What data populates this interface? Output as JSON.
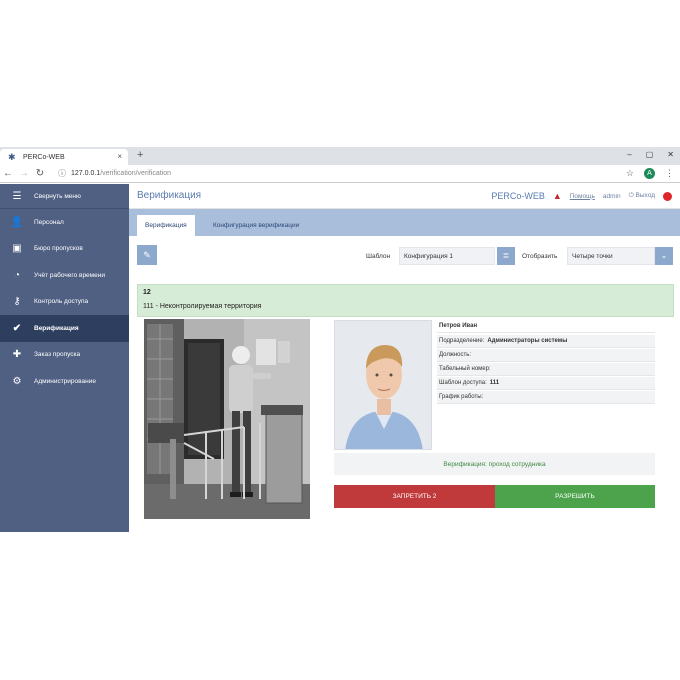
{
  "browser": {
    "tab_title": "PERCo-WEB",
    "tab_close": "×",
    "new_tab": "+",
    "url_host": "127.0.0.1",
    "url_path": "/verification/verification",
    "minimize": "–",
    "restore": "▢",
    "close": "✕",
    "profile_initial": "A"
  },
  "sidebar": {
    "items": [
      {
        "label": "Свернуть меню",
        "icon": "menu-icon"
      },
      {
        "label": "Персонал",
        "icon": "person-icon"
      },
      {
        "label": "Бюро пропусков",
        "icon": "id-card-icon"
      },
      {
        "label": "Учёт рабочего времени",
        "icon": "clock-person-icon"
      },
      {
        "label": "Контроль доступа",
        "icon": "key-icon"
      },
      {
        "label": "Верификация",
        "icon": "verify-person-icon"
      },
      {
        "label": "Заказ пропуска",
        "icon": "order-pass-icon"
      },
      {
        "label": "Администрирование",
        "icon": "gear-icon"
      }
    ],
    "active_index": 5
  },
  "header": {
    "title": "Верификация",
    "brand": "PERCo-WEB",
    "help": "Помощь",
    "user": "admin",
    "logout": "Выход"
  },
  "tabs": [
    {
      "label": "Верификация",
      "active": true
    },
    {
      "label": "Конфигурация верификации",
      "active": false
    }
  ],
  "toolbar": {
    "template_label": "Шаблон",
    "template_value": "Конфигурация 1",
    "display_label": "Отобразить",
    "display_value": "Четыре точки"
  },
  "event": {
    "number": "12",
    "zone": "111 - Неконтролируемая территория"
  },
  "employee": {
    "name": "Петров Иван",
    "rows": [
      {
        "label": "Подразделение:",
        "value": "Администраторы системы"
      },
      {
        "label": "Должность:",
        "value": ""
      },
      {
        "label": "Табельный номер:",
        "value": ""
      },
      {
        "label": "Шаблон доступа:",
        "value": "111"
      },
      {
        "label": "График работы:",
        "value": ""
      }
    ]
  },
  "verification": {
    "status": "Верификация: проход сотрудника",
    "deny_label": "ЗАПРЕТИТЬ 2",
    "allow_label": "РАЗРЕШИТЬ"
  },
  "colors": {
    "sidebar": "#4f6083",
    "sidebar_active": "#2d3e5e",
    "tabs_bar": "#a8bedb",
    "accent": "#5a7bb0",
    "deny": "#c0393b",
    "allow": "#4ca34b",
    "event_bg": "#d7ecd6"
  }
}
